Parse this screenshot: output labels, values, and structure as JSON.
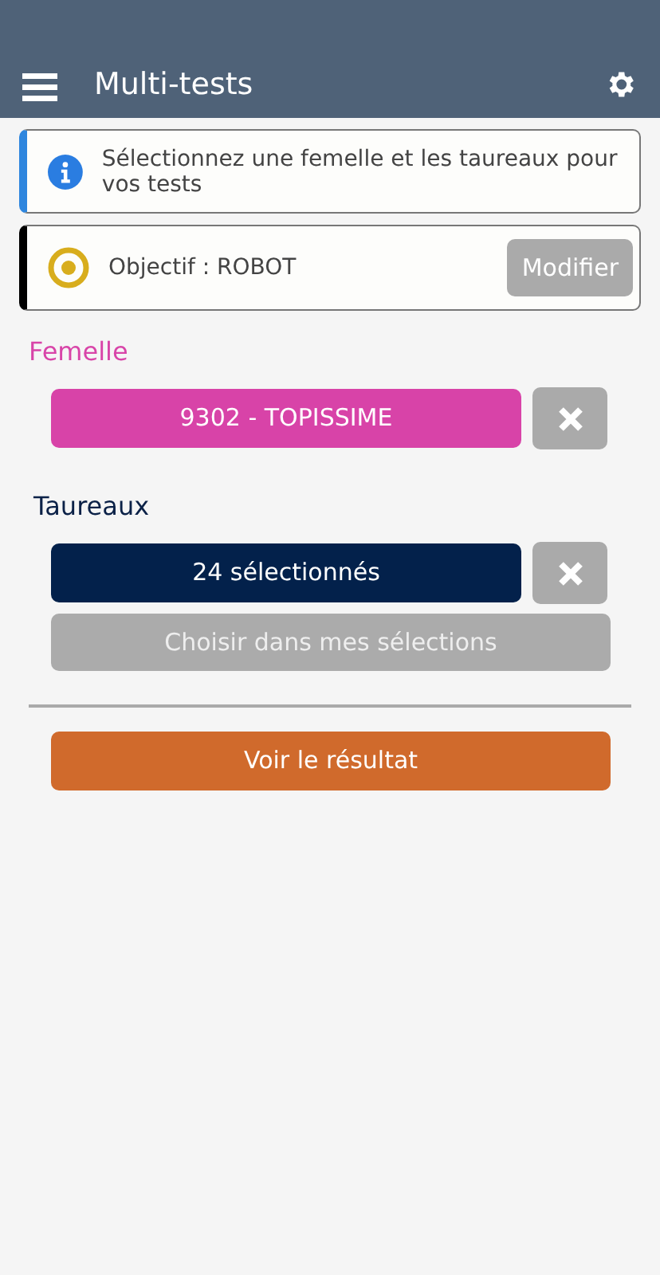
{
  "header": {
    "title": "Multi-tests"
  },
  "info": {
    "text": "Sélectionnez une femelle et les taureaux pour vos tests"
  },
  "objective": {
    "text": "Objectif : ROBOT",
    "button": "Modifier"
  },
  "female": {
    "label": "Femelle",
    "value": "9302 - TOPISSIME"
  },
  "bulls": {
    "label": "Taureaux",
    "value": "24 sélectionnés",
    "choose_button": "Choisir dans mes sélections"
  },
  "result_button": "Voir le résultat"
}
